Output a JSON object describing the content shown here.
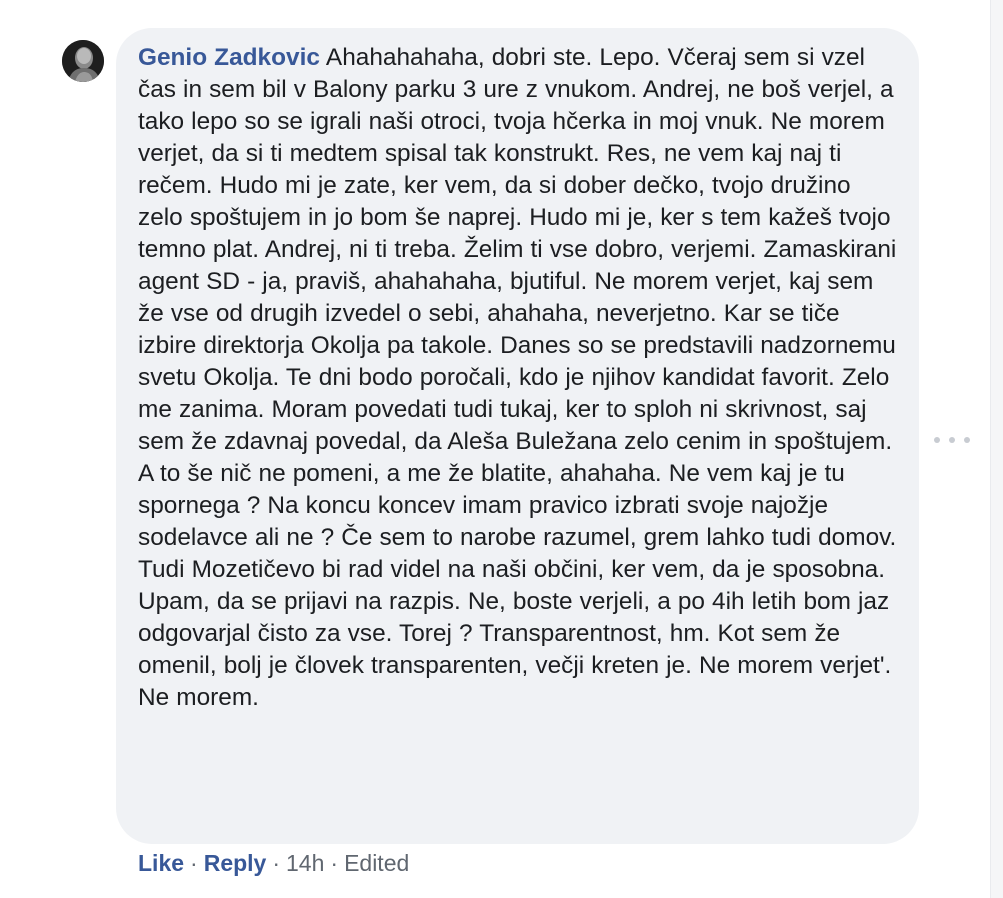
{
  "comment": {
    "author": "Genio Zadkovic",
    "text": "Ahahahahaha, dobri ste. Lepo. Včeraj sem si vzel čas in sem bil v Balony parku 3 ure z vnukom. Andrej, ne boš verjel, a tako lepo so se igrali naši otroci, tvoja hčerka in moj vnuk. Ne morem verjet, da si ti medtem spisal tak konstrukt. Res, ne vem kaj naj ti rečem. Hudo mi je zate, ker vem, da si dober dečko, tvojo družino zelo spoštujem in jo bom še naprej. Hudo mi je, ker s tem kažeš tvojo temno plat. Andrej, ni ti treba. Želim ti vse dobro, verjemi. Zamaskirani agent SD - ja, praviš, ahahahaha, bjutiful. Ne morem verjet, kaj sem že vse od drugih izvedel o sebi, ahahaha, neverjetno. Kar se tiče izbire direktorja Okolja pa takole. Danes so se predstavili nadzornemu svetu Okolja. Te dni bodo poročali, kdo je njihov kandidat favorit. Zelo me zanima. Moram povedati tudi tukaj, ker to sploh ni skrivnost, saj sem že zdavnaj povedal, da Aleša Buležana zelo cenim in spoštujem. A to še nič ne pomeni, a me že blatite, ahahaha. Ne vem kaj je tu spornega ? Na koncu koncev imam pravico izbrati svoje najožje sodelavce ali ne ? Če sem to narobe razumel, grem lahko tudi domov. Tudi Mozetičevo bi rad videl na naši občini, ker vem, da je sposobna. Upam, da se prijavi na razpis. Ne, boste verjeli, a po 4ih letih bom jaz odgovarjal čisto za vse. Torej ? Transparentnost, hm. Kot sem že omenil, bolj je človek transparenten, večji kreten je. Ne morem verjet'. Ne morem."
  },
  "actions": {
    "like": "Like",
    "reply": "Reply",
    "time": "14h",
    "edited": "Edited",
    "separator": "·"
  },
  "icons": {
    "avatar": "profile-photo",
    "more": "more-options-icon"
  },
  "colors": {
    "author": "#385898",
    "bubble": "#f0f2f5",
    "meta": "#606770"
  }
}
